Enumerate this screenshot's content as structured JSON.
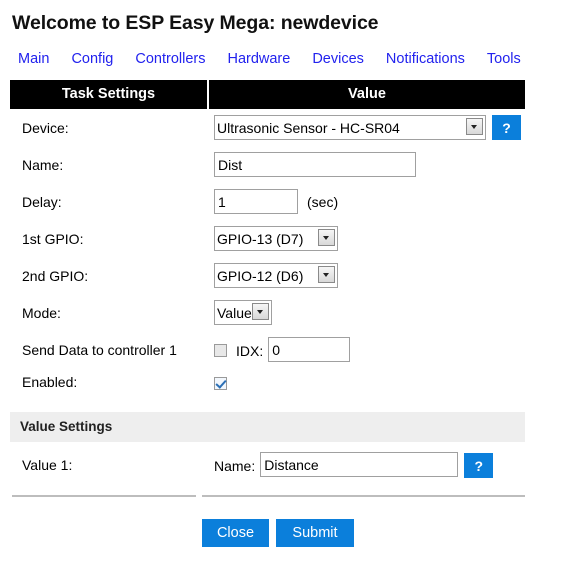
{
  "page": {
    "title": "Welcome to ESP Easy Mega: newdevice"
  },
  "nav": {
    "items": [
      {
        "label": "Main"
      },
      {
        "label": "Config"
      },
      {
        "label": "Controllers"
      },
      {
        "label": "Hardware"
      },
      {
        "label": "Devices"
      },
      {
        "label": "Notifications"
      },
      {
        "label": "Tools"
      }
    ]
  },
  "task_settings": {
    "header_left": "Task Settings",
    "header_right": "Value",
    "rows": {
      "device": {
        "label": "Device:",
        "value": "Ultrasonic Sensor - HC-SR04",
        "help_label": "?"
      },
      "name": {
        "label": "Name:",
        "value": "Dist"
      },
      "delay": {
        "label": "Delay:",
        "value": "1",
        "suffix": "(sec)"
      },
      "gpio1": {
        "label": "1st GPIO:",
        "value": "GPIO-13 (D7)"
      },
      "gpio2": {
        "label": "2nd GPIO:",
        "value": "GPIO-12 (D6)"
      },
      "mode": {
        "label": "Mode:",
        "value": "Value"
      },
      "send_data": {
        "label": "Send Data to controller 1",
        "checked": false,
        "idx_label": "IDX:",
        "idx_value": "0"
      },
      "enabled": {
        "label": "Enabled:",
        "checked": true
      }
    }
  },
  "value_settings": {
    "section_title": "Value Settings",
    "rows": [
      {
        "label": "Value 1:",
        "name_label": "Name:",
        "name_value": "Distance",
        "help_label": "?"
      }
    ]
  },
  "buttons": {
    "close": "Close",
    "submit": "Submit"
  },
  "colors": {
    "accent_blue": "#0b7fdb",
    "link_blue": "#2222ee",
    "header_black": "#000000",
    "band_gray": "#eeeeee"
  }
}
